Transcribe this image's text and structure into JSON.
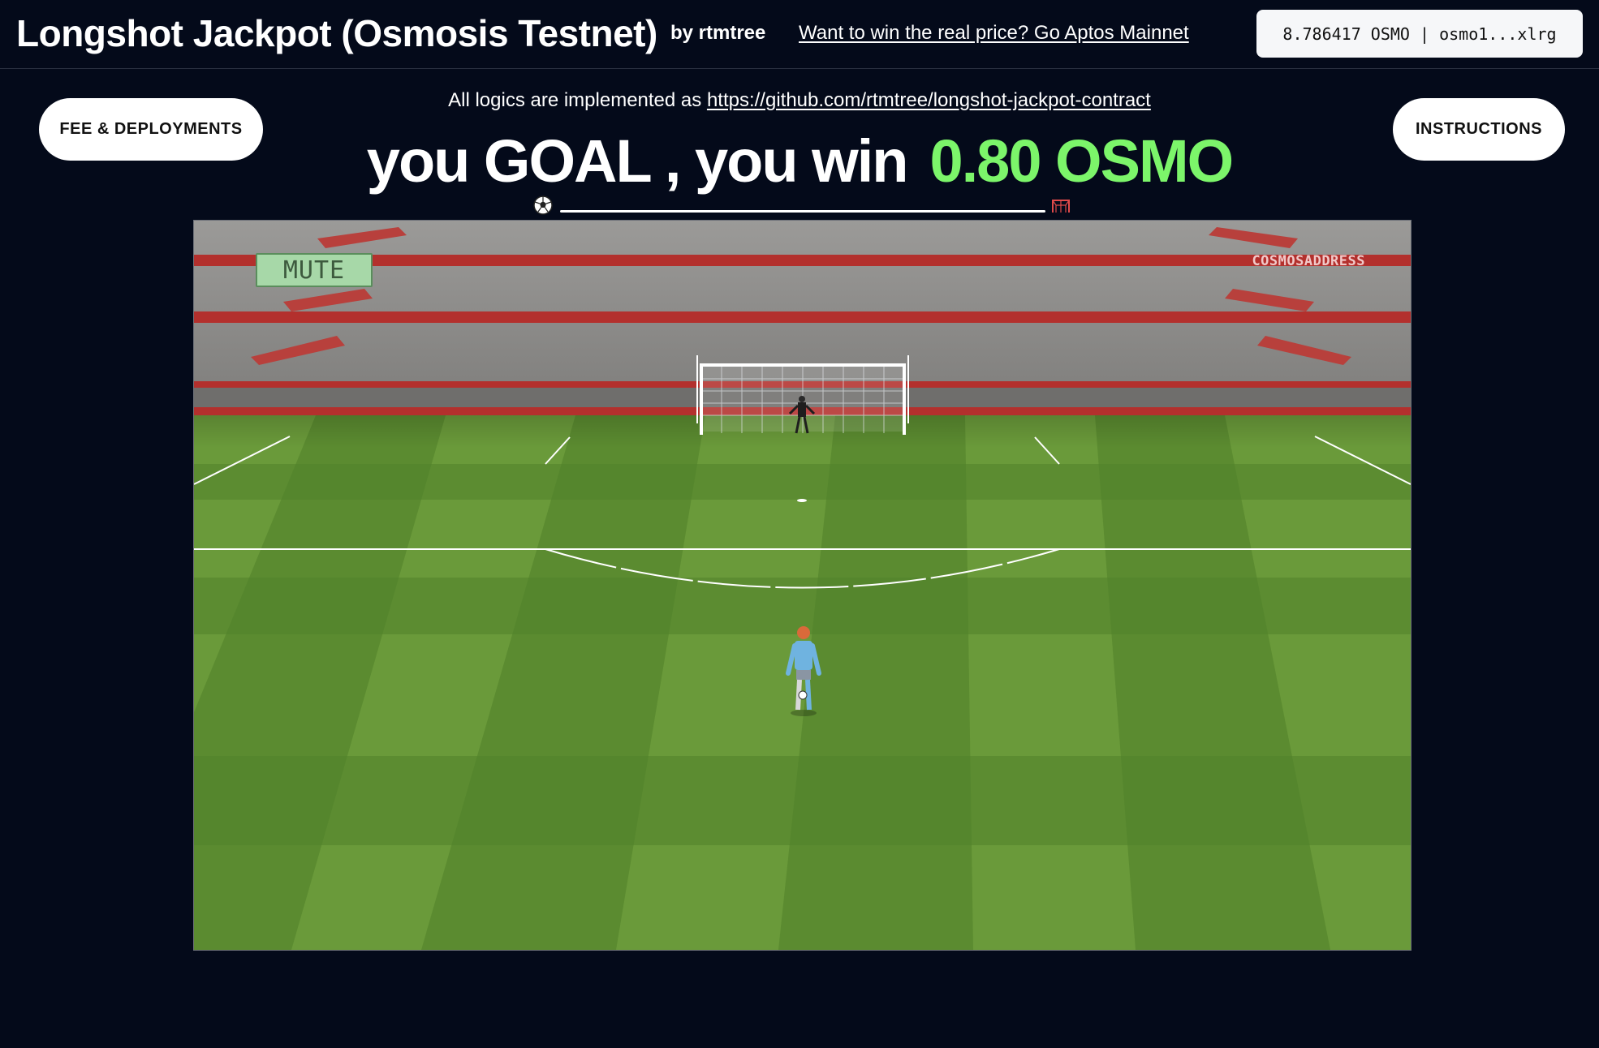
{
  "header": {
    "title": "Longshot Jackpot (Osmosis Testnet)",
    "author": "by rtmtree",
    "mainnet_link": "Want to win the real price? Go Aptos Mainnet",
    "wallet": "8.786417 OSMO | osmo1...xlrg"
  },
  "main": {
    "fee_button": "FEE & DEPLOYMENTS",
    "instructions_button": "INSTRUCTIONS",
    "repo_prefix": "All logics are implemented as",
    "repo_url": "https://github.com/rtmtree/longshot-jackpot-contract",
    "result_text": "you GOAL , you win",
    "prize": "0.80 OSMO",
    "power_level": 0
  },
  "game": {
    "mute_label": "MUTE",
    "address_label": "COSMOSADDRESS"
  },
  "colors": {
    "background": "#040a1a",
    "prize": "#7cf56a",
    "stand_red": "#b52a28",
    "pitch_green": "#6a9a3a"
  }
}
